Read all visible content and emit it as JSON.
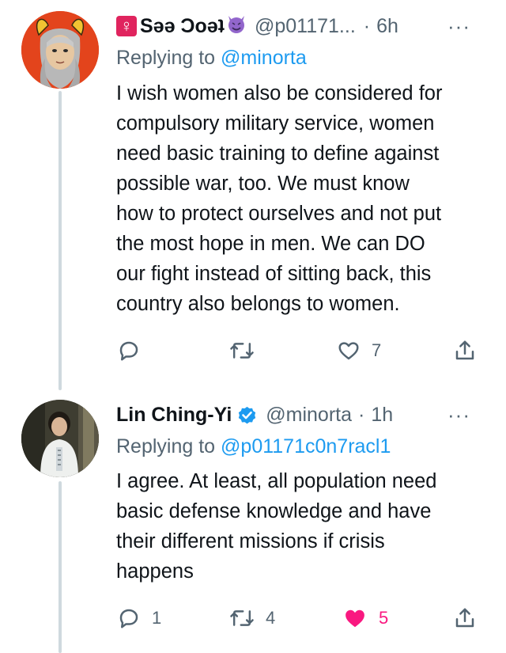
{
  "tweets": [
    {
      "name_prefix_emoji": "♀",
      "name": "Sǝǝ Ɔoǝʇ",
      "name_suffix_emoji": "😈",
      "handle": "@p01171...",
      "dot": "·",
      "time": "6h",
      "more": "···",
      "replying_to_prefix": "Replying to",
      "replying_to_handle": "@minorta",
      "text": "I wish women also be considered for\ncompulsory military service, women\nneed basic training to define against\npossible war, too. We must know\nhow to protect ourselves and not put\nthe most hope in men. We can DO\nour fight instead of sitting back, this\ncountry also belongs to women.",
      "actions": {
        "reply_count": "",
        "retweet_count": "",
        "like_count": "7",
        "liked": false
      }
    },
    {
      "name": "Lin Ching-Yi",
      "verified": true,
      "handle": "@minorta",
      "dot": "·",
      "time": "1h",
      "more": "···",
      "replying_to_prefix": "Replying to",
      "replying_to_handle": "@p01171c0n7racl1",
      "text": "I agree. At least, all population need\nbasic defense knowledge and have\ntheir different missions if crisis\nhappens",
      "actions": {
        "reply_count": "1",
        "retweet_count": "4",
        "like_count": "5",
        "liked": true
      }
    }
  ],
  "colors": {
    "link": "#1d9bf0",
    "muted": "#536471",
    "like": "#f91880",
    "thread_line": "#cfd9de"
  }
}
